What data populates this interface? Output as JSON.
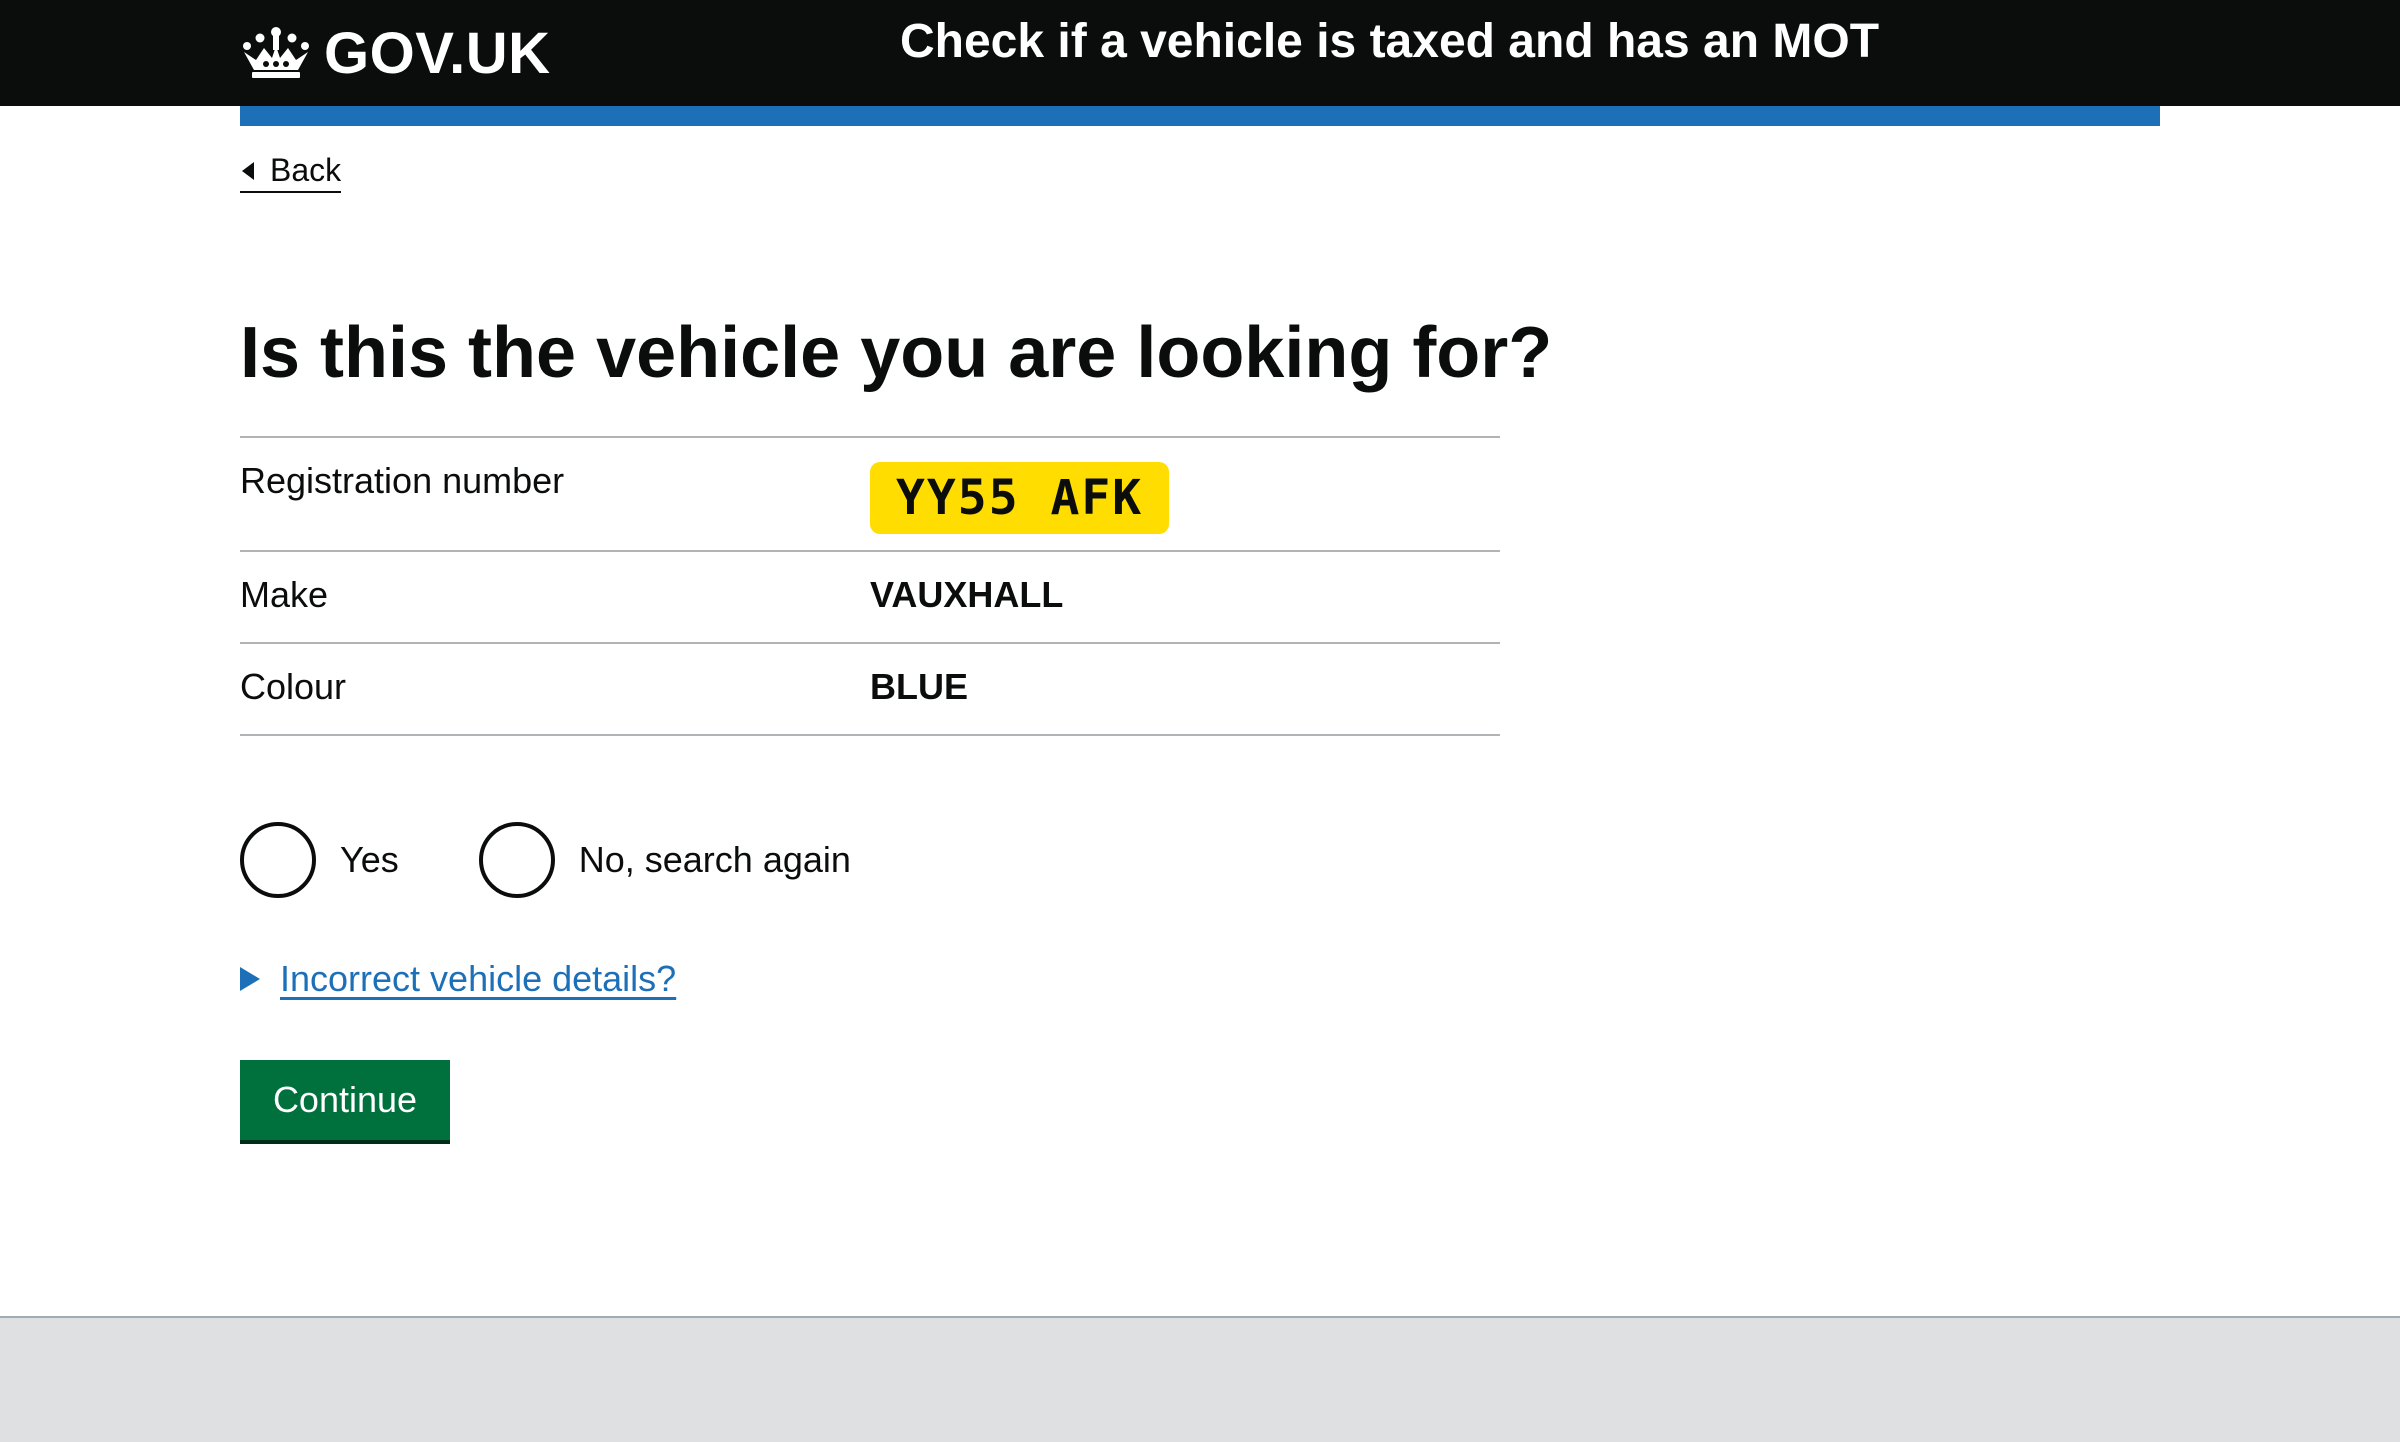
{
  "header": {
    "logo_text": "GOV.UK",
    "service_name": "Check if a vehicle is taxed and has an MOT"
  },
  "back": {
    "label": "Back"
  },
  "page_title": "Is this the vehicle you are looking for?",
  "summary": {
    "rows": [
      {
        "key": "Registration number",
        "value": "YY55 AFK"
      },
      {
        "key": "Make",
        "value": "VAUXHALL"
      },
      {
        "key": "Colour",
        "value": "BLUE"
      }
    ]
  },
  "radios": {
    "options": [
      {
        "label": "Yes",
        "selected": false
      },
      {
        "label": "No, search again",
        "selected": false
      }
    ]
  },
  "details": {
    "summary_label": "Incorrect vehicle details?"
  },
  "continue": {
    "label": "Continue"
  },
  "colors": {
    "header_bg": "#0b0c0c",
    "blue_bar": "#1d70b8",
    "plate_yellow": "#ffdd00",
    "button_green": "#00703c",
    "link_blue": "#1d70b8",
    "footer_bg": "#dfe0e2"
  },
  "icons": {
    "logo": "crown-icon",
    "back": "triangle-left-icon",
    "details": "triangle-right-icon"
  }
}
